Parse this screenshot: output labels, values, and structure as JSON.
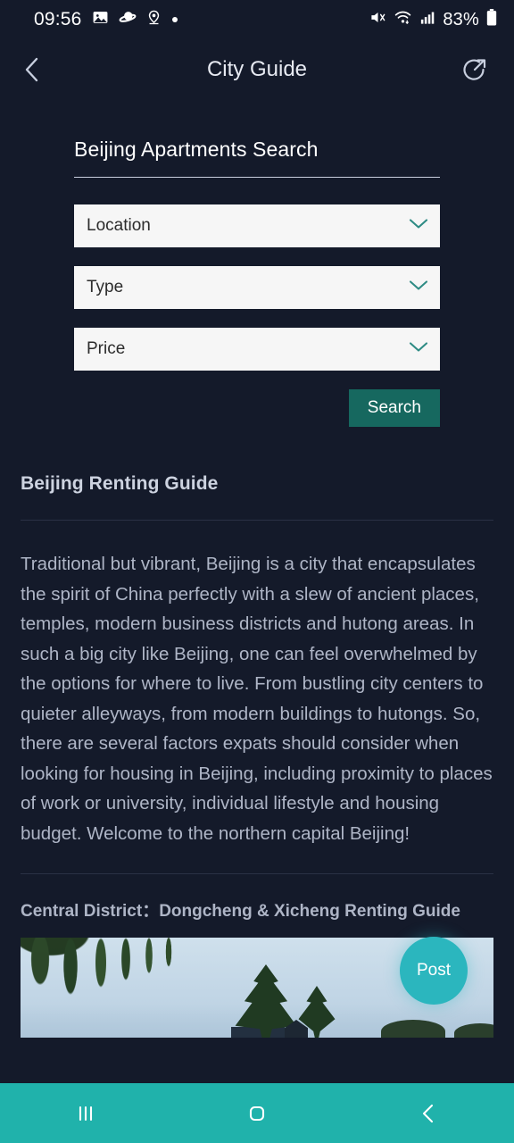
{
  "status_bar": {
    "time": "09:56",
    "battery_percent": "83%",
    "left_icons": [
      "photo-icon",
      "saturn-icon",
      "location-pin-icon",
      "dot-icon"
    ],
    "right_icons": [
      "mute-icon",
      "wifi-icon",
      "signal-icon",
      "battery-icon"
    ]
  },
  "app_bar": {
    "title": "City Guide",
    "back_icon": "chevron-left-icon",
    "share_icon": "share-icon"
  },
  "search_panel": {
    "title": "Beijing Apartments Search",
    "fields": [
      {
        "label": "Location",
        "icon": "chevron-down-icon"
      },
      {
        "label": "Type",
        "icon": "chevron-down-icon"
      },
      {
        "label": "Price",
        "icon": "chevron-down-icon"
      }
    ],
    "search_button": "Search"
  },
  "guide": {
    "heading": "Beijing Renting Guide",
    "paragraph": "Traditional but vibrant, Beijing is a city that encapsulates the spirit of China perfectly with a slew of ancient places, temples, modern business districts and hutong areas. In such a big city like Beijing, one can feel overwhelmed by the options for where to live. From bustling city centers to quieter alleyways, from modern buildings to hutongs. So, there are several factors expats should consider when looking for housing in Beijing, including proximity to places of work or university, individual lifestyle and housing budget. Welcome to the northern capital Beijing!",
    "section_heading": "Central District：Dongcheng & Xicheng Renting Guide",
    "photo_alt": "park-photo-willow-trees"
  },
  "fab": {
    "label": "Post"
  },
  "nav_bar": {
    "recents_icon": "recents-icon",
    "home_icon": "home-icon",
    "back_icon": "back-icon"
  },
  "colors": {
    "background": "#141a2a",
    "accent_teal": "#2bb6be",
    "nav_teal": "#20b2ab",
    "search_button": "#16685f",
    "field_background": "#f6f6f6"
  }
}
